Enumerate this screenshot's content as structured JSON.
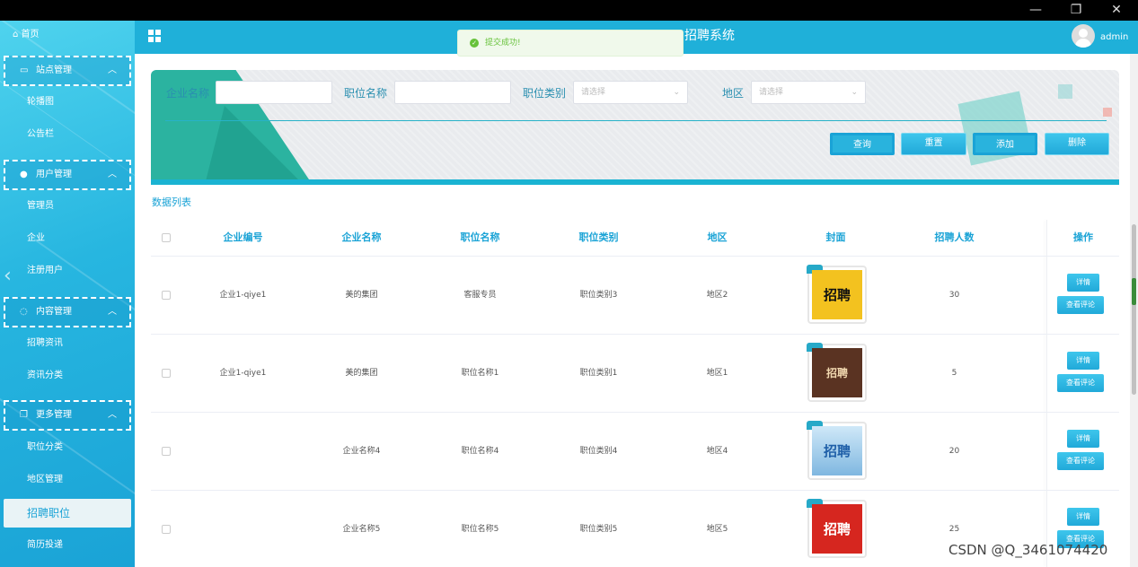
{
  "os": {
    "minimize": "—",
    "restore": "❐",
    "close": "✕"
  },
  "sidebar": {
    "home": "首页",
    "groups": [
      {
        "label": "站点管理",
        "items": [
          "轮播图",
          "公告栏"
        ]
      },
      {
        "label": "用户管理",
        "items": [
          "管理员",
          "企业",
          "注册用户"
        ]
      },
      {
        "label": "内容管理",
        "items": [
          "招聘资讯",
          "资讯分类"
        ]
      },
      {
        "label": "更多管理",
        "items": [
          "职位分类",
          "地区管理"
        ]
      }
    ],
    "active": "招聘职位",
    "last": "简历投递"
  },
  "header": {
    "title": "招聘系统",
    "user": "admin"
  },
  "toast": {
    "text": "提交成功!"
  },
  "search": {
    "company_label": "企业名称",
    "company_value": "",
    "job_label": "职位名称",
    "job_value": "",
    "category_label": "职位类别",
    "category_placeholder": "请选择",
    "region_label": "地区",
    "region_placeholder": "请选择",
    "buttons": {
      "query": "查询",
      "reset": "重置",
      "add": "添加",
      "delete": "删除"
    }
  },
  "list": {
    "label": "数据列表",
    "headers": [
      "企业编号",
      "企业名称",
      "职位名称",
      "职位类别",
      "地区",
      "封面",
      "招聘人数",
      "操作"
    ],
    "rows": [
      {
        "id": "企业1-qiye1",
        "company": "美的集团",
        "job": "客服专员",
        "category": "职位类别3",
        "region": "地区2",
        "cover": "招聘",
        "count": "30"
      },
      {
        "id": "企业1-qiye1",
        "company": "美的集团",
        "job": "职位名称1",
        "category": "职位类别1",
        "region": "地区1",
        "cover": "招聘",
        "count": "5"
      },
      {
        "id": "",
        "company": "企业名称4",
        "job": "职位名称4",
        "category": "职位类别4",
        "region": "地区4",
        "cover": "招聘",
        "count": "20"
      },
      {
        "id": "",
        "company": "企业名称5",
        "job": "职位名称5",
        "category": "职位类别5",
        "region": "地区5",
        "cover": "招聘",
        "count": "25"
      }
    ],
    "detail_label": "详情",
    "review_label": "查看评论"
  },
  "watermark": "CSDN @Q_3461074420"
}
